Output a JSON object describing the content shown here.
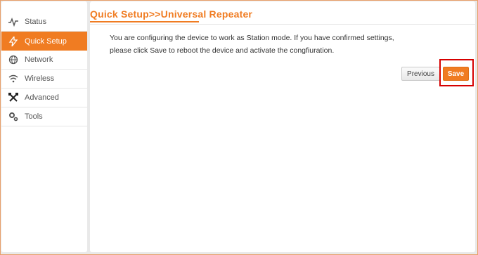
{
  "sidebar": {
    "items": [
      {
        "label": "Status",
        "icon": "pulse-icon",
        "active": false
      },
      {
        "label": "Quick Setup",
        "icon": "lightning-icon",
        "active": true
      },
      {
        "label": "Network",
        "icon": "globe-icon",
        "active": false
      },
      {
        "label": "Wireless",
        "icon": "wifi-icon",
        "active": false
      },
      {
        "label": "Advanced",
        "icon": "tools-cross-icon",
        "active": false
      },
      {
        "label": "Tools",
        "icon": "gears-icon",
        "active": false
      }
    ]
  },
  "main": {
    "title": "Quick Setup>>Universal Repeater",
    "message_line1": "You are configuring the device to work as Station mode. If you have confirmed settings,",
    "message_line2": "please click Save to reboot the device and activate the congfiuration.",
    "previous_label": "Previous",
    "save_label": "Save"
  },
  "colors": {
    "accent": "#f07c22",
    "highlight": "#d60000"
  }
}
